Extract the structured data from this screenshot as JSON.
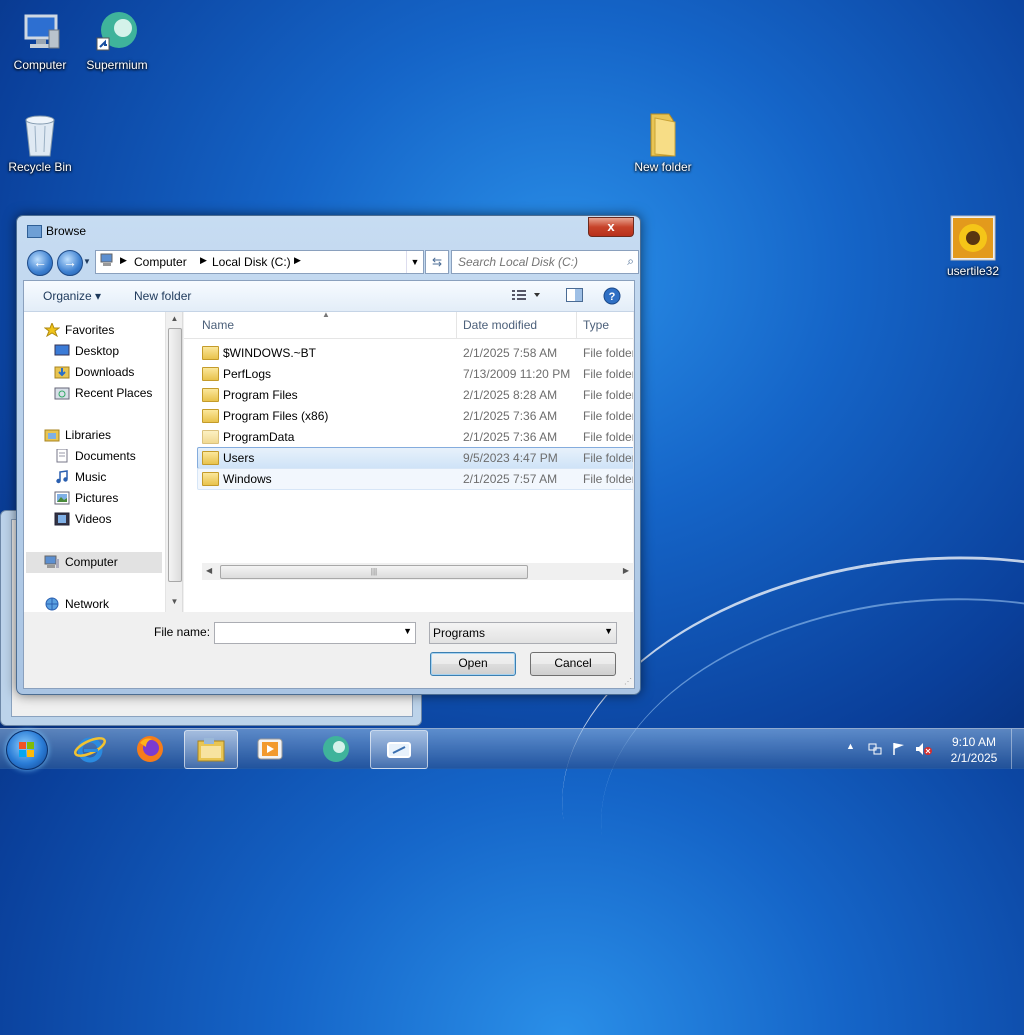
{
  "desktop": {
    "icons": [
      {
        "label": "Computer",
        "icon": "computer-icon"
      },
      {
        "label": "Supermium",
        "icon": "supermium-icon"
      },
      {
        "label": "Recycle Bin",
        "icon": "recycle-bin-icon"
      },
      {
        "label": "New folder",
        "icon": "folder-icon"
      },
      {
        "label": "usertile32",
        "icon": "sunflower-image-icon"
      }
    ]
  },
  "dialog": {
    "title": "Browse",
    "close_label": "x",
    "address": {
      "parts": [
        "Computer",
        "Local Disk (C:)"
      ]
    },
    "search_placeholder": "Search Local Disk (C:)",
    "toolbar": {
      "organize_label": "Organize ▾",
      "new_folder_label": "New folder"
    },
    "nav": {
      "favorites": "Favorites",
      "desktop": "Desktop",
      "downloads": "Downloads",
      "recent_places": "Recent Places",
      "libraries": "Libraries",
      "documents": "Documents",
      "music": "Music",
      "pictures": "Pictures",
      "videos": "Videos",
      "computer": "Computer",
      "network": "Network"
    },
    "columns": {
      "name": "Name",
      "date_modified": "Date modified",
      "type": "Type"
    },
    "files": [
      {
        "name": "$WINDOWS.~BT",
        "date": "2/1/2025 7:58 AM",
        "type": "File folder"
      },
      {
        "name": "PerfLogs",
        "date": "7/13/2009 11:20 PM",
        "type": "File folder"
      },
      {
        "name": "Program Files",
        "date": "2/1/2025 8:28 AM",
        "type": "File folder"
      },
      {
        "name": "Program Files (x86)",
        "date": "2/1/2025 7:36 AM",
        "type": "File folder"
      },
      {
        "name": "ProgramData",
        "date": "2/1/2025 7:36 AM",
        "type": "File folder"
      },
      {
        "name": "Users",
        "date": "9/5/2023 4:47 PM",
        "type": "File folder"
      },
      {
        "name": "Windows",
        "date": "2/1/2025 7:57 AM",
        "type": "File folder"
      }
    ],
    "file_name_label": "File name:",
    "file_name_value": "",
    "filter_value": "Programs",
    "open_label": "Open",
    "cancel_label": "Cancel"
  },
  "taskbar": {
    "clock_time": "9:10 AM",
    "clock_date": "2/1/2025"
  }
}
